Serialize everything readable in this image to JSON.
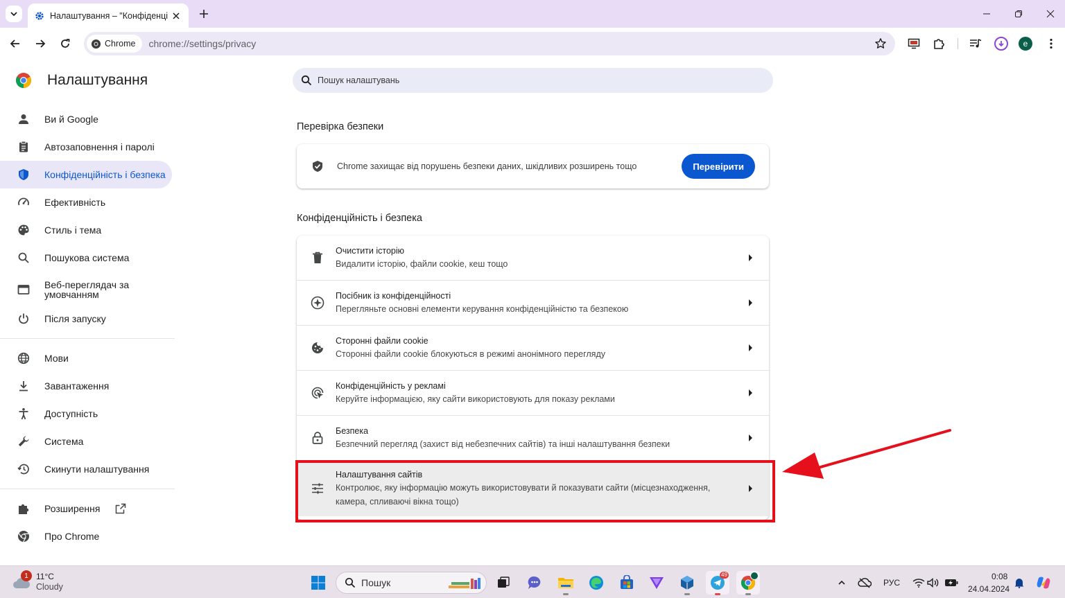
{
  "browser": {
    "tab_title": "Налаштування – \"Конфіденційність і безпека\"",
    "chip_label": "Chrome",
    "url": "chrome://settings/privacy"
  },
  "sidebar": {
    "title": "Налаштування",
    "items": [
      {
        "label": "Ви й Google",
        "icon": "person-icon"
      },
      {
        "label": "Автозаповнення і паролі",
        "icon": "clipboard-icon"
      },
      {
        "label": "Конфіденційність і безпека",
        "icon": "shield-icon",
        "active": true
      },
      {
        "label": "Ефективність",
        "icon": "speedometer-icon"
      },
      {
        "label": "Стиль і тема",
        "icon": "palette-icon"
      },
      {
        "label": "Пошукова система",
        "icon": "search-icon"
      },
      {
        "label": "Веб-переглядач за умовчанням",
        "icon": "browser-window-icon"
      },
      {
        "label": "Після запуску",
        "icon": "power-icon"
      },
      {
        "label": "Мови",
        "icon": "globe-icon"
      },
      {
        "label": "Завантаження",
        "icon": "download-icon"
      },
      {
        "label": "Доступність",
        "icon": "accessibility-icon"
      },
      {
        "label": "Система",
        "icon": "wrench-icon"
      },
      {
        "label": "Скинути налаштування",
        "icon": "history-icon"
      },
      {
        "label": "Розширення",
        "icon": "puzzle-icon"
      },
      {
        "label": "Про Chrome",
        "icon": "chrome-icon"
      }
    ]
  },
  "search": {
    "placeholder": "Пошук налаштувань"
  },
  "safety_check": {
    "section_title": "Перевірка безпеки",
    "text": "Chrome захищає від порушень безпеки даних, шкідливих розширень тощо",
    "button": "Перевірити"
  },
  "privacy": {
    "section_title": "Конфіденційність і безпека",
    "rows": [
      {
        "title": "Очистити історію",
        "subtitle": "Видалити історію, файли cookie, кеш тощо",
        "icon": "trash-icon"
      },
      {
        "title": "Посібник із конфіденційності",
        "subtitle": "Перегляньте основні елементи керування конфіденційністю та безпекою",
        "icon": "compass-icon"
      },
      {
        "title": "Сторонні файли cookie",
        "subtitle": "Сторонні файли cookie блокуються в режимі анонімного перегляду",
        "icon": "cookie-icon"
      },
      {
        "title": "Конфіденційність у рекламі",
        "subtitle": "Керуйте інформацією, яку сайти використовують для показу реклами",
        "icon": "ad-privacy-icon"
      },
      {
        "title": "Безпека",
        "subtitle": "Безпечний перегляд (захист від небезпечних сайтів) та інші налаштування безпеки",
        "icon": "lock-icon"
      },
      {
        "title": "Налаштування сайтів",
        "subtitle": "Контролює, яку інформацію можуть використовувати й показувати сайти (місцезнаходження, камера, спливаючі вікна тощо)",
        "icon": "sliders-icon",
        "highlighted": true
      }
    ]
  },
  "taskbar": {
    "weather_temp": "11°C",
    "weather_cond": "Cloudy",
    "weather_badge": "1",
    "search_placeholder": "Пошук",
    "telegram_badge": "49",
    "language": "РУС",
    "time": "0:08",
    "date": "24.04.2024"
  },
  "colors": {
    "accent": "#0b57d0",
    "annotation": "#e5101c",
    "tabstrip": "#e8dcf7"
  }
}
